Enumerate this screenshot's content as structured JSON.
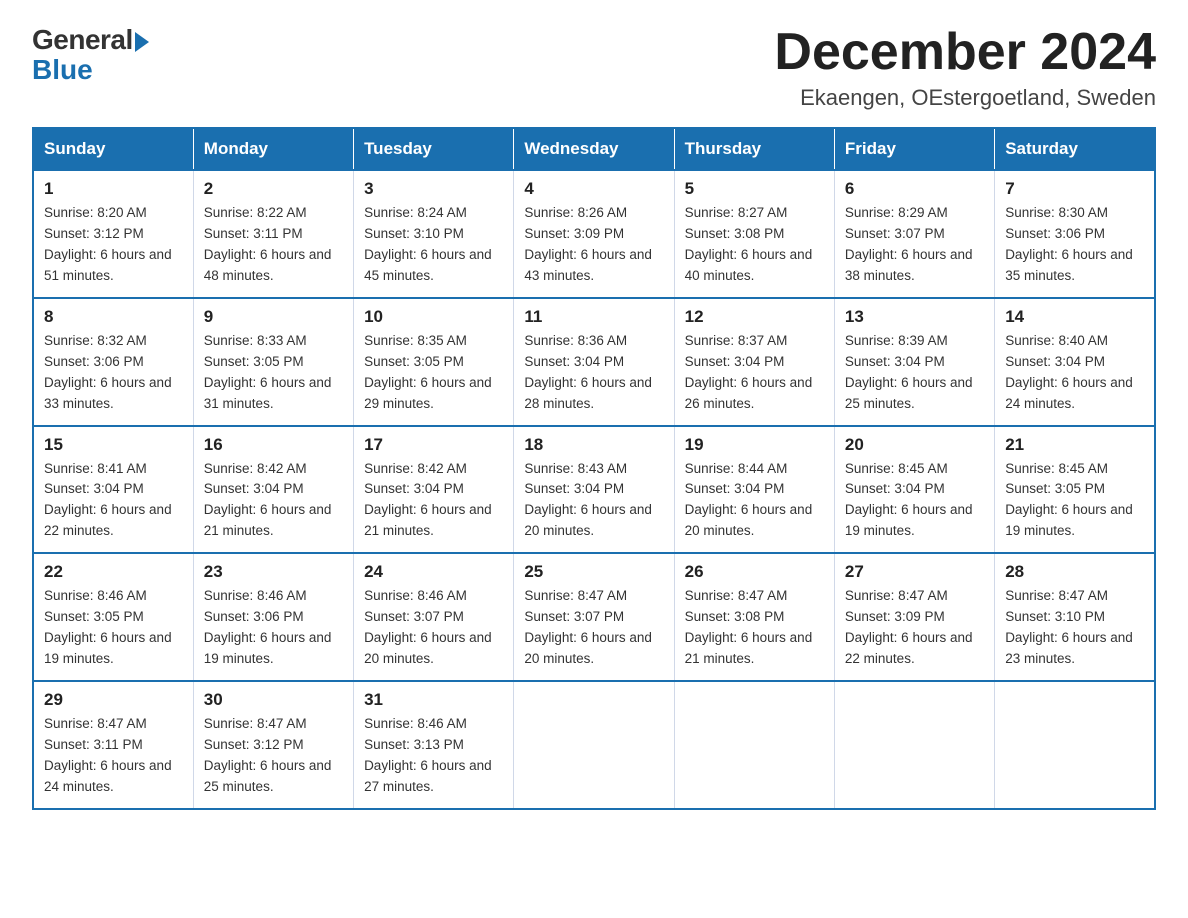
{
  "header": {
    "logo_general": "General",
    "logo_blue": "Blue",
    "month_title": "December 2024",
    "location": "Ekaengen, OEstergoetland, Sweden"
  },
  "days_of_week": [
    "Sunday",
    "Monday",
    "Tuesday",
    "Wednesday",
    "Thursday",
    "Friday",
    "Saturday"
  ],
  "weeks": [
    [
      {
        "day": "1",
        "sunrise": "8:20 AM",
        "sunset": "3:12 PM",
        "daylight": "6 hours and 51 minutes."
      },
      {
        "day": "2",
        "sunrise": "8:22 AM",
        "sunset": "3:11 PM",
        "daylight": "6 hours and 48 minutes."
      },
      {
        "day": "3",
        "sunrise": "8:24 AM",
        "sunset": "3:10 PM",
        "daylight": "6 hours and 45 minutes."
      },
      {
        "day": "4",
        "sunrise": "8:26 AM",
        "sunset": "3:09 PM",
        "daylight": "6 hours and 43 minutes."
      },
      {
        "day": "5",
        "sunrise": "8:27 AM",
        "sunset": "3:08 PM",
        "daylight": "6 hours and 40 minutes."
      },
      {
        "day": "6",
        "sunrise": "8:29 AM",
        "sunset": "3:07 PM",
        "daylight": "6 hours and 38 minutes."
      },
      {
        "day": "7",
        "sunrise": "8:30 AM",
        "sunset": "3:06 PM",
        "daylight": "6 hours and 35 minutes."
      }
    ],
    [
      {
        "day": "8",
        "sunrise": "8:32 AM",
        "sunset": "3:06 PM",
        "daylight": "6 hours and 33 minutes."
      },
      {
        "day": "9",
        "sunrise": "8:33 AM",
        "sunset": "3:05 PM",
        "daylight": "6 hours and 31 minutes."
      },
      {
        "day": "10",
        "sunrise": "8:35 AM",
        "sunset": "3:05 PM",
        "daylight": "6 hours and 29 minutes."
      },
      {
        "day": "11",
        "sunrise": "8:36 AM",
        "sunset": "3:04 PM",
        "daylight": "6 hours and 28 minutes."
      },
      {
        "day": "12",
        "sunrise": "8:37 AM",
        "sunset": "3:04 PM",
        "daylight": "6 hours and 26 minutes."
      },
      {
        "day": "13",
        "sunrise": "8:39 AM",
        "sunset": "3:04 PM",
        "daylight": "6 hours and 25 minutes."
      },
      {
        "day": "14",
        "sunrise": "8:40 AM",
        "sunset": "3:04 PM",
        "daylight": "6 hours and 24 minutes."
      }
    ],
    [
      {
        "day": "15",
        "sunrise": "8:41 AM",
        "sunset": "3:04 PM",
        "daylight": "6 hours and 22 minutes."
      },
      {
        "day": "16",
        "sunrise": "8:42 AM",
        "sunset": "3:04 PM",
        "daylight": "6 hours and 21 minutes."
      },
      {
        "day": "17",
        "sunrise": "8:42 AM",
        "sunset": "3:04 PM",
        "daylight": "6 hours and 21 minutes."
      },
      {
        "day": "18",
        "sunrise": "8:43 AM",
        "sunset": "3:04 PM",
        "daylight": "6 hours and 20 minutes."
      },
      {
        "day": "19",
        "sunrise": "8:44 AM",
        "sunset": "3:04 PM",
        "daylight": "6 hours and 20 minutes."
      },
      {
        "day": "20",
        "sunrise": "8:45 AM",
        "sunset": "3:04 PM",
        "daylight": "6 hours and 19 minutes."
      },
      {
        "day": "21",
        "sunrise": "8:45 AM",
        "sunset": "3:05 PM",
        "daylight": "6 hours and 19 minutes."
      }
    ],
    [
      {
        "day": "22",
        "sunrise": "8:46 AM",
        "sunset": "3:05 PM",
        "daylight": "6 hours and 19 minutes."
      },
      {
        "day": "23",
        "sunrise": "8:46 AM",
        "sunset": "3:06 PM",
        "daylight": "6 hours and 19 minutes."
      },
      {
        "day": "24",
        "sunrise": "8:46 AM",
        "sunset": "3:07 PM",
        "daylight": "6 hours and 20 minutes."
      },
      {
        "day": "25",
        "sunrise": "8:47 AM",
        "sunset": "3:07 PM",
        "daylight": "6 hours and 20 minutes."
      },
      {
        "day": "26",
        "sunrise": "8:47 AM",
        "sunset": "3:08 PM",
        "daylight": "6 hours and 21 minutes."
      },
      {
        "day": "27",
        "sunrise": "8:47 AM",
        "sunset": "3:09 PM",
        "daylight": "6 hours and 22 minutes."
      },
      {
        "day": "28",
        "sunrise": "8:47 AM",
        "sunset": "3:10 PM",
        "daylight": "6 hours and 23 minutes."
      }
    ],
    [
      {
        "day": "29",
        "sunrise": "8:47 AM",
        "sunset": "3:11 PM",
        "daylight": "6 hours and 24 minutes."
      },
      {
        "day": "30",
        "sunrise": "8:47 AM",
        "sunset": "3:12 PM",
        "daylight": "6 hours and 25 minutes."
      },
      {
        "day": "31",
        "sunrise": "8:46 AM",
        "sunset": "3:13 PM",
        "daylight": "6 hours and 27 minutes."
      },
      null,
      null,
      null,
      null
    ]
  ],
  "labels": {
    "sunrise": "Sunrise:",
    "sunset": "Sunset:",
    "daylight": "Daylight:"
  }
}
